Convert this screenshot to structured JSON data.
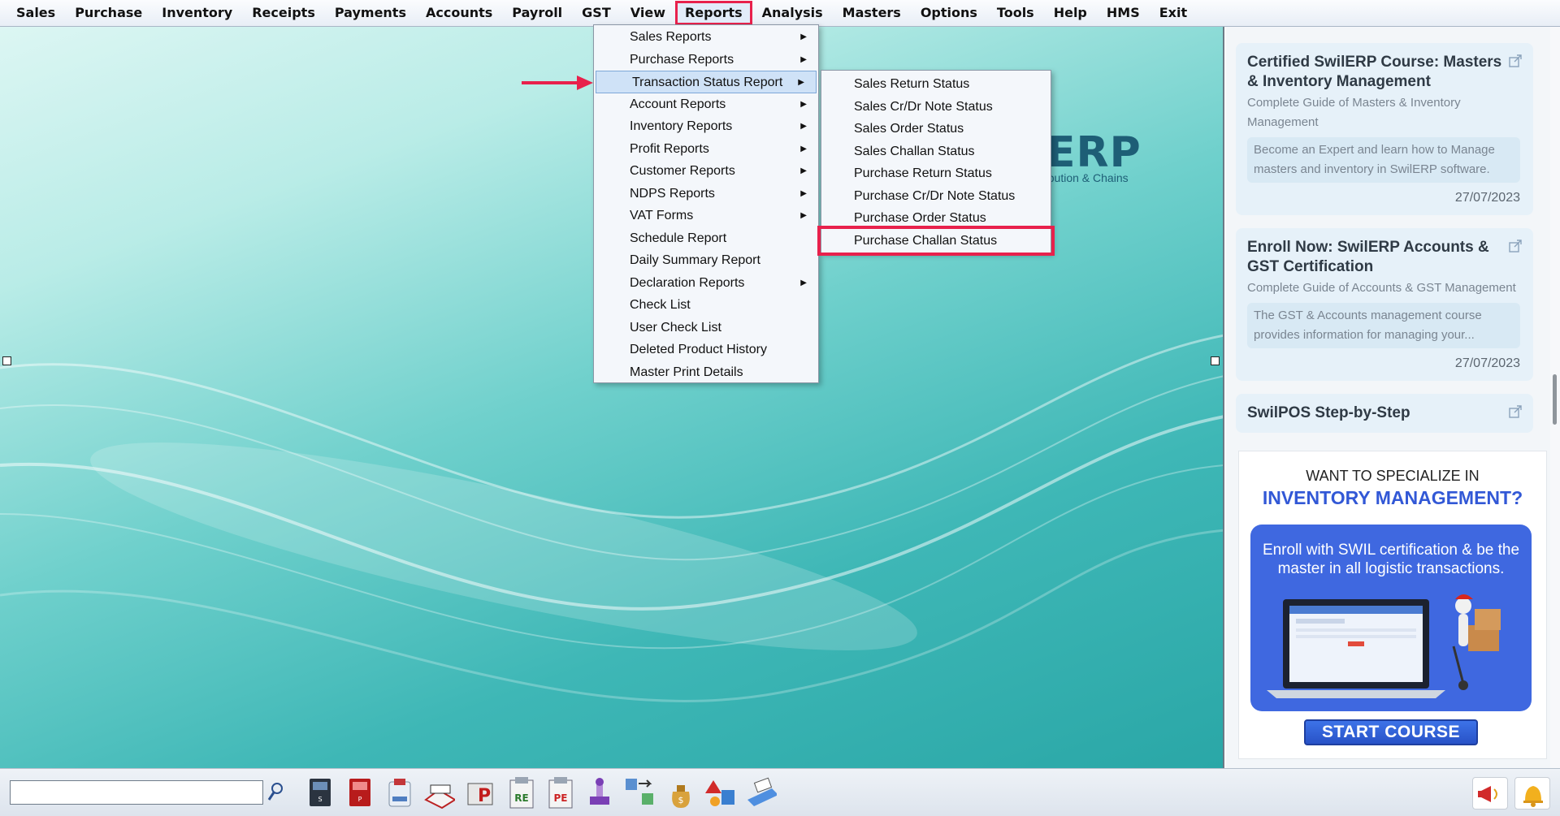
{
  "menubar": {
    "items": [
      "Sales",
      "Purchase",
      "Inventory",
      "Receipts",
      "Payments",
      "Accounts",
      "Payroll",
      "GST",
      "View",
      "Reports",
      "Analysis",
      "Masters",
      "Options",
      "Tools",
      "Help",
      "HMS",
      "Exit"
    ],
    "active": "Reports"
  },
  "reports_menu": {
    "items": [
      {
        "label": "Sales Reports",
        "submenu": true
      },
      {
        "label": "Purchase Reports",
        "submenu": true
      },
      {
        "label": "Transaction Status Report",
        "submenu": true,
        "hover": true
      },
      {
        "label": "Account Reports",
        "submenu": true
      },
      {
        "label": "Inventory Reports",
        "submenu": true
      },
      {
        "label": "Profit Reports",
        "submenu": true
      },
      {
        "label": "Customer Reports",
        "submenu": true
      },
      {
        "label": "NDPS Reports",
        "submenu": true
      },
      {
        "label": "VAT Forms",
        "submenu": true
      },
      {
        "label": "Schedule Report",
        "submenu": false
      },
      {
        "label": "Daily Summary Report",
        "submenu": false
      },
      {
        "label": "Declaration Reports",
        "submenu": true
      },
      {
        "label": "Check List",
        "submenu": false
      },
      {
        "label": "User Check List",
        "submenu": false
      },
      {
        "label": "Deleted Product History",
        "submenu": false
      },
      {
        "label": "Master Print Details",
        "submenu": false
      }
    ]
  },
  "transaction_status_menu": {
    "items": [
      "Sales Return Status",
      "Sales Cr/Dr Note Status",
      "Sales Order Status",
      "Sales Challan Status",
      "Purchase Return Status",
      "Purchase Cr/Dr Note Status",
      "Purchase Order Status",
      "Purchase Challan Status"
    ],
    "highlighted": "Purchase Challan Status"
  },
  "background_logo": {
    "text": "ERP",
    "tagline": "ribution & Chains"
  },
  "feed": {
    "cards": [
      {
        "title": "Certified SwilERP Course: Masters & Inventory Management",
        "subtitle": "Complete Guide of Masters & Inventory Management",
        "description": "Become an Expert and learn how to Manage masters and inventory in SwilERP software.",
        "date": "27/07/2023"
      },
      {
        "title": "Enroll Now: SwilERP Accounts & GST Certification",
        "subtitle": "Complete Guide of Accounts & GST Management",
        "description": "The GST & Accounts management course provides information for managing your...",
        "date": "27/07/2023"
      },
      {
        "title": "SwilPOS Step-by-Step",
        "subtitle": "",
        "description": "",
        "date": ""
      }
    ]
  },
  "ad": {
    "line1": "WANT TO SPECIALIZE IN",
    "line2": "INVENTORY MANAGEMENT?",
    "body": "Enroll with SWIL certification & be the master in all logistic transactions.",
    "cta": "START COURSE"
  },
  "toolbar": {
    "search_value": "",
    "icons": [
      "sale-book-icon",
      "purchase-book-icon",
      "payment-icon",
      "order-book-icon",
      "print-icon",
      "receipt-entry-icon",
      "purchase-entry-icon",
      "stamp-icon",
      "transfer-icon",
      "money-bag-icon",
      "shapes-icon",
      "printer-icon"
    ]
  },
  "colors": {
    "highlight": "#e8214c",
    "accent": "#3f68e0"
  }
}
